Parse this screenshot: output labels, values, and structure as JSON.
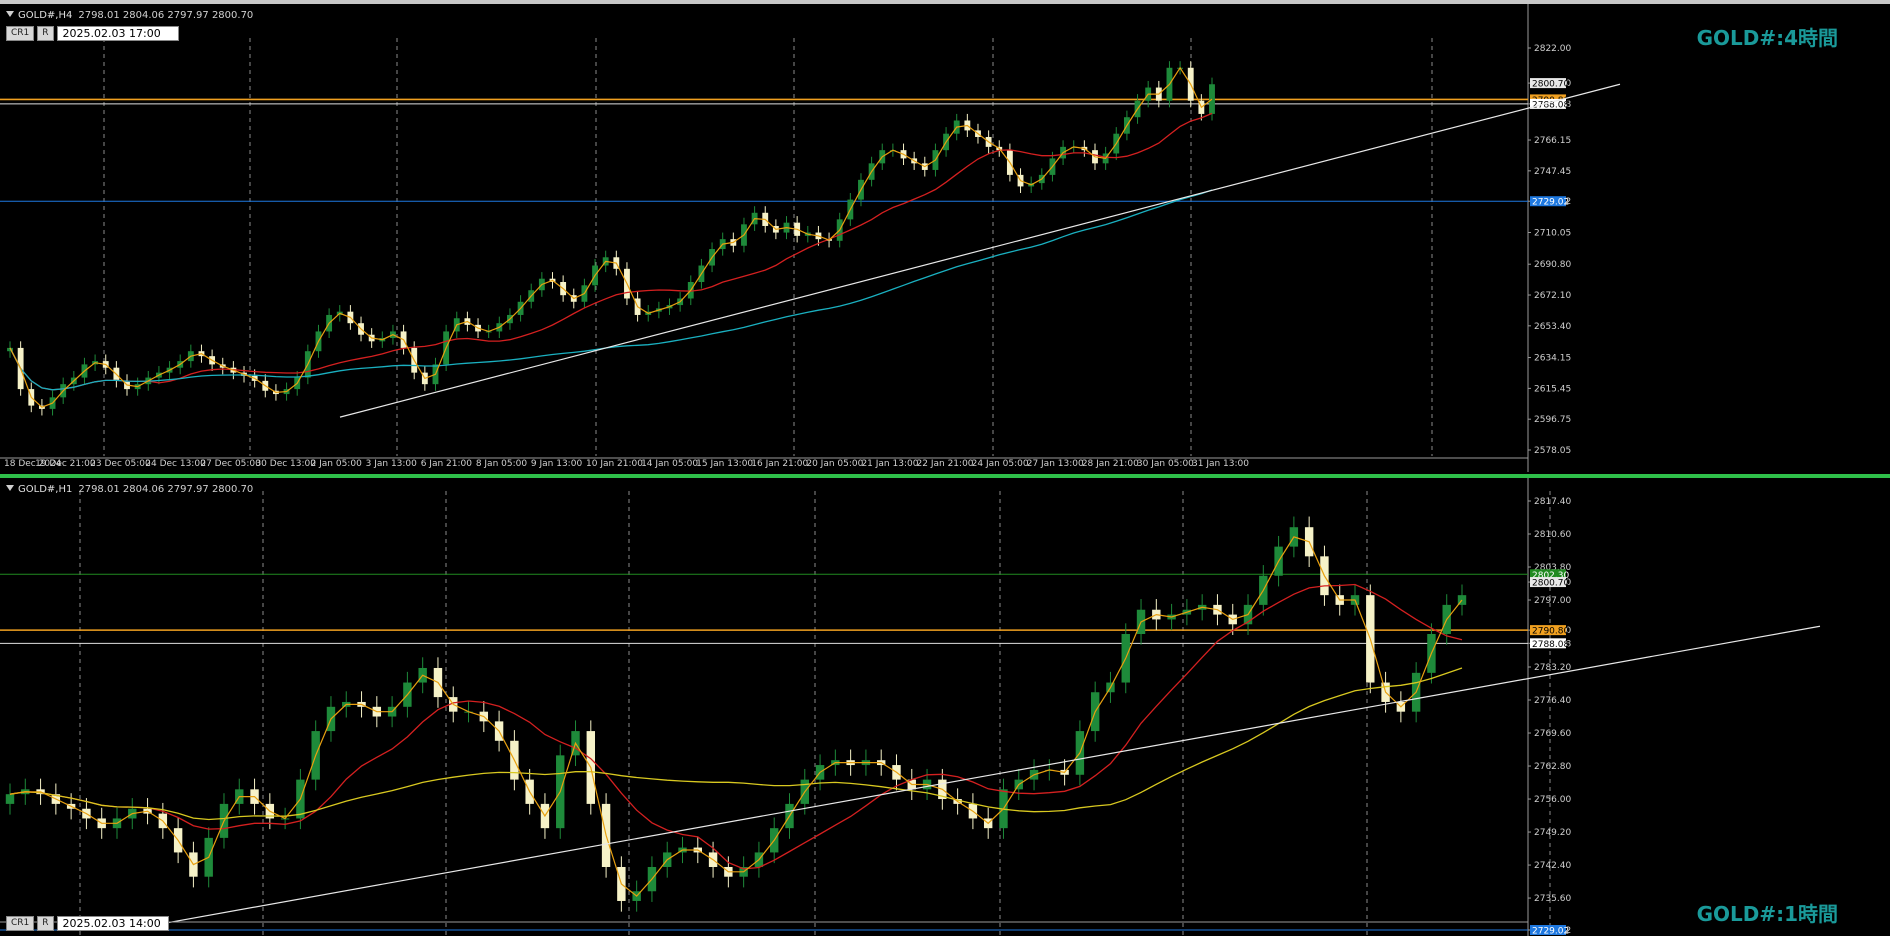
{
  "colors": {
    "background": "#000000",
    "grid": "#8a8a8a",
    "candle_up": "#1e8a3a",
    "candle_down": "#f6f2c8",
    "ma_fast": "#e8a010",
    "ma_red": "#d42020",
    "ma_cyan": "#1ab0c0",
    "ma_yellow": "#d8c820",
    "h_orange": "#f0a020",
    "h_white": "#e0e0e0",
    "h_blue": "#1e78e0",
    "h_green": "#208a20",
    "title_teal": "#1a9a9a"
  },
  "h4": {
    "symbol": "GOLD#,H4",
    "ohlc": "2798.01 2804.06 2797.97 2800.70",
    "btn_cr": "CR1",
    "btn_r": "R",
    "datetime": "2025.02.03 17:00",
    "title": "GOLD#:4時間",
    "price_labels": [
      "2822.00",
      "2800.70",
      "2788.08",
      "2766.15",
      "2747.45",
      "2729.02",
      "2710.05",
      "2690.80",
      "2672.10",
      "2653.40",
      "2634.15",
      "2615.45",
      "2596.75",
      "2578.05"
    ],
    "time_labels": [
      "18 Dec 2024",
      "19 Dec 21:00",
      "23 Dec 05:00",
      "24 Dec 13:00",
      "27 Dec 05:00",
      "30 Dec 13:00",
      "2 Jan 05:00",
      "3 Jan 13:00",
      "6 Jan 21:00",
      "8 Jan 05:00",
      "9 Jan 13:00",
      "10 Jan 21:00",
      "14 Jan 05:00",
      "15 Jan 13:00",
      "16 Jan 21:00",
      "20 Jan 05:00",
      "21 Jan 13:00",
      "22 Jan 21:00",
      "24 Jan 05:00",
      "27 Jan 13:00",
      "28 Jan 21:00",
      "30 Jan 05:00",
      "31 Jan 13:00"
    ],
    "levels": [
      {
        "name": "current",
        "value": "2800.70",
        "color": "#000000",
        "bg": "#e8e8e8"
      },
      {
        "name": "orange",
        "value": "2790.80",
        "color": "#000000",
        "bg": "#f0a020"
      },
      {
        "name": "white",
        "value": "2788.08",
        "color": "#000000",
        "bg": "#ffffff"
      },
      {
        "name": "blue",
        "value": "2729.02",
        "color": "#ffffff",
        "bg": "#1e78e0"
      }
    ],
    "close": [
      2640,
      2615,
      2605,
      2603,
      2610,
      2618,
      2622,
      2630,
      2632,
      2628,
      2620,
      2615,
      2618,
      2622,
      2625,
      2628,
      2632,
      2638,
      2635,
      2630,
      2628,
      2625,
      2623,
      2620,
      2614,
      2612,
      2615,
      2622,
      2638,
      2650,
      2660,
      2662,
      2655,
      2648,
      2644,
      2646,
      2650,
      2640,
      2625,
      2618,
      2630,
      2650,
      2658,
      2654,
      2650,
      2650,
      2655,
      2660,
      2668,
      2675,
      2682,
      2680,
      2672,
      2668,
      2678,
      2690,
      2695,
      2688,
      2670,
      2660,
      2662,
      2664,
      2666,
      2670,
      2680,
      2690,
      2700,
      2706,
      2702,
      2715,
      2722,
      2714,
      2710,
      2716,
      2708,
      2710,
      2706,
      2705,
      2718,
      2730,
      2742,
      2752,
      2760,
      2760,
      2755,
      2752,
      2748,
      2760,
      2770,
      2778,
      2772,
      2768,
      2762,
      2760,
      2745,
      2738,
      2740,
      2745,
      2755,
      2762,
      2762,
      2760,
      2752,
      2758,
      2770,
      2780,
      2790,
      2798,
      2790,
      2810,
      2810,
      2790,
      2782,
      2800
    ]
  },
  "h1": {
    "symbol": "GOLD#,H1",
    "ohlc": "2798.01 2804.06 2797.97 2800.70",
    "btn_cr": "CR1",
    "btn_r": "R",
    "datetime": "2025.02.03 14:00",
    "title": "GOLD#:1時間",
    "price_labels": [
      "2817.40",
      "2810.60",
      "2803.80",
      "2800.70",
      "2797.00",
      "2790.80",
      "2788.08",
      "2783.20",
      "2776.40",
      "2769.60",
      "2762.80",
      "2756.00",
      "2749.20",
      "2742.40",
      "2735.60",
      "2729.02"
    ],
    "levels": [
      {
        "name": "green",
        "value": "2802.30",
        "color": "#ffffff",
        "bg": "#208a20"
      },
      {
        "name": "current",
        "value": "2800.70",
        "color": "#000000",
        "bg": "#e8e8e8"
      },
      {
        "name": "orange",
        "value": "2790.80",
        "color": "#000000",
        "bg": "#f0a020"
      },
      {
        "name": "white",
        "value": "2788.08",
        "color": "#000000",
        "bg": "#ffffff"
      },
      {
        "name": "blue",
        "value": "2729.02",
        "color": "#ffffff",
        "bg": "#1e78e0"
      }
    ],
    "close": [
      2757,
      2758,
      2757,
      2755,
      2754,
      2752,
      2750,
      2752,
      2754,
      2753,
      2750,
      2745,
      2740,
      2748,
      2755,
      2758,
      2755,
      2752,
      2752,
      2760,
      2770,
      2775,
      2776,
      2775,
      2773,
      2775,
      2780,
      2783,
      2777,
      2774,
      2774,
      2772,
      2768,
      2760,
      2755,
      2750,
      2765,
      2770,
      2755,
      2742,
      2735,
      2737,
      2742,
      2745,
      2746,
      2745,
      2742,
      2740,
      2742,
      2745,
      2750,
      2755,
      2760,
      2763,
      2764,
      2763,
      2764,
      2763,
      2760,
      2758,
      2760,
      2756,
      2755,
      2752,
      2750,
      2758,
      2760,
      2762,
      2762,
      2761,
      2770,
      2778,
      2780,
      2790,
      2795,
      2793,
      2794,
      2795,
      2796,
      2794,
      2792,
      2796,
      2802,
      2808,
      2812,
      2806,
      2798,
      2796,
      2798,
      2780,
      2776,
      2774,
      2782,
      2790,
      2796,
      2798
    ]
  }
}
